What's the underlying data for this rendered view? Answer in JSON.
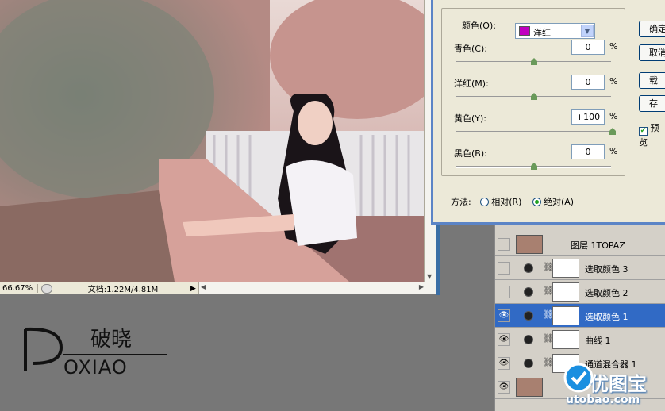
{
  "status": {
    "zoom": "66.67%",
    "doc": "文档:1.22M/4.81M",
    "arrow": "▶"
  },
  "dialog": {
    "colors_label": "颜色(O):",
    "colors_value": "洋红",
    "sliders": [
      {
        "label": "青色(C):",
        "value": "0",
        "pct": "%",
        "pos": 0.5
      },
      {
        "label": "洋红(M):",
        "value": "0",
        "pct": "%",
        "pos": 0.5
      },
      {
        "label": "黄色(Y):",
        "value": "+100",
        "pct": "%",
        "pos": 1.0
      },
      {
        "label": "黑色(B):",
        "value": "0",
        "pct": "%",
        "pos": 0.5
      }
    ],
    "buttons": [
      "确定",
      "取消",
      "载入...",
      "存储..."
    ],
    "preview_label": "预览",
    "method_label": "方法:",
    "method_relative": "相对(R)",
    "method_absolute": "绝对(A)",
    "method_selected": "absolute",
    "accent_color": "#c000c0"
  },
  "layers": [
    {
      "name": "图层 1TOPAZ",
      "visible": false,
      "type": "pixel"
    },
    {
      "name": "选取颜色 3",
      "visible": false,
      "type": "adjust"
    },
    {
      "name": "选取颜色 2",
      "visible": false,
      "type": "adjust"
    },
    {
      "name": "选取颜色 1",
      "visible": true,
      "type": "adjust",
      "selected": true
    },
    {
      "name": "曲线 1",
      "visible": true,
      "type": "adjust"
    },
    {
      "name": "通道混合器 1",
      "visible": true,
      "type": "adjust"
    },
    {
      "name": "",
      "visible": true,
      "type": "pixel"
    }
  ],
  "logo": {
    "chinese": "破晓",
    "latin": "OXIAO"
  },
  "watermark": {
    "cn": "优图宝",
    "url": "utobao.com"
  }
}
